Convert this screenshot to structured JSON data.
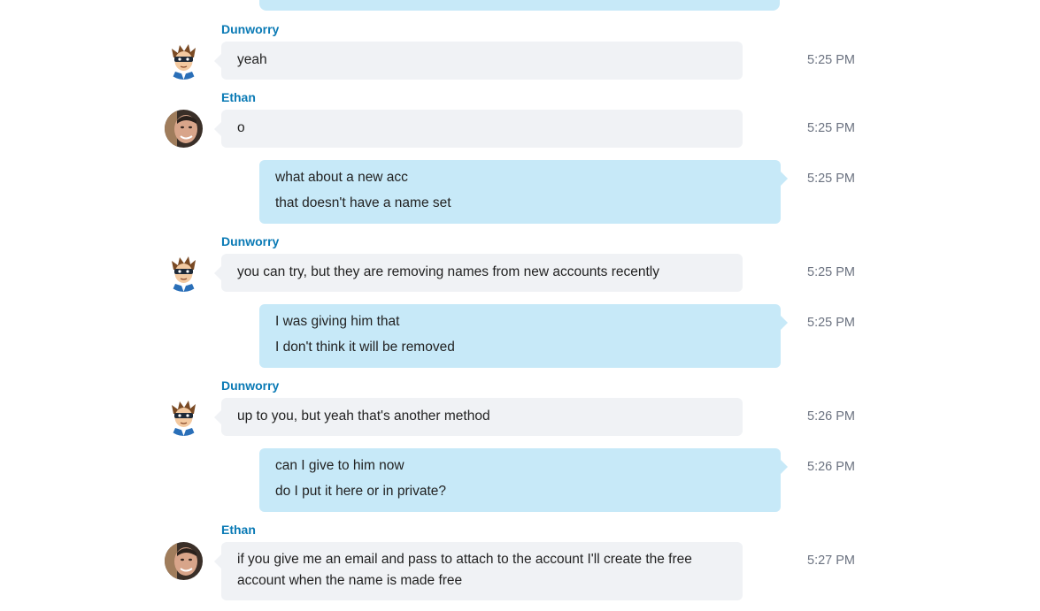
{
  "colors": {
    "sender_name": "#0a7ab5",
    "incoming_bubble": "#f0f2f5",
    "outgoing_bubble": "#c7e9f8",
    "timestamp": "#6b7280"
  },
  "messages": [
    {
      "sender": "Dunworry",
      "avatar": "cartoon-avatar-icon",
      "direction": "incoming",
      "lines": [
        "yeah"
      ],
      "time": "5:25 PM"
    },
    {
      "sender": "Ethan",
      "avatar": "photo-avatar-icon",
      "direction": "incoming",
      "lines": [
        "o"
      ],
      "time": "5:25 PM"
    },
    {
      "direction": "outgoing",
      "lines": [
        "what about a new acc",
        "that doesn't have a name set"
      ],
      "time": "5:25 PM"
    },
    {
      "sender": "Dunworry",
      "avatar": "cartoon-avatar-icon",
      "direction": "incoming",
      "lines": [
        "you can try, but they are removing names from new accounts recently"
      ],
      "time": "5:25 PM"
    },
    {
      "direction": "outgoing",
      "lines": [
        "I was giving him that",
        "I don't think it will be removed"
      ],
      "time": "5:25 PM"
    },
    {
      "sender": "Dunworry",
      "avatar": "cartoon-avatar-icon",
      "direction": "incoming",
      "lines": [
        "up to you, but yeah that's another method"
      ],
      "time": "5:26 PM"
    },
    {
      "direction": "outgoing",
      "lines": [
        "can I give to him now",
        "do I put it here or in private?"
      ],
      "time": "5:26 PM"
    },
    {
      "sender": "Ethan",
      "avatar": "photo-avatar-icon",
      "direction": "incoming",
      "lines": [
        "if you give me an email and pass to attach to the account I'll create the free account when the name is made free"
      ],
      "time": "5:27 PM"
    }
  ]
}
